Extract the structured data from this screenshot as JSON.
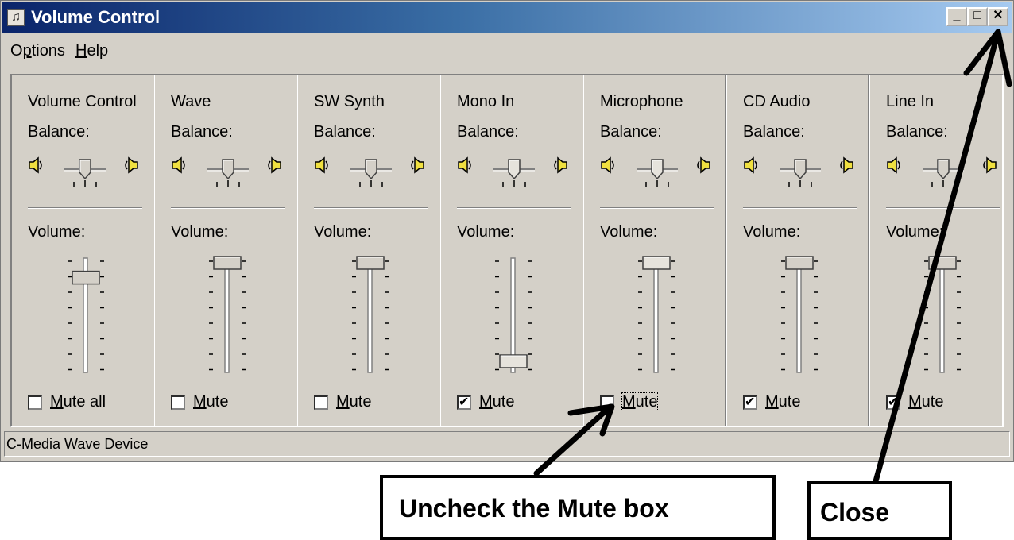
{
  "window": {
    "title": "Volume Control",
    "controls": {
      "minimize": "_",
      "maximize": "□",
      "close": "✕"
    }
  },
  "menu": [
    {
      "label": "Options",
      "underline_index": 1
    },
    {
      "label": "Help",
      "underline_index": 0
    }
  ],
  "panels": [
    {
      "name": "Volume Control",
      "balance_label": "Balance:",
      "volume_label": "Volume:",
      "mute_label": "Mute all",
      "muted": false,
      "volume_level": 0.85,
      "disabled": false
    },
    {
      "name": "Wave",
      "balance_label": "Balance:",
      "volume_label": "Volume:",
      "mute_label": "Mute",
      "muted": false,
      "volume_level": 1.0,
      "disabled": false
    },
    {
      "name": "SW Synth",
      "balance_label": "Balance:",
      "volume_label": "Volume:",
      "mute_label": "Mute",
      "muted": false,
      "volume_level": 1.0,
      "disabled": false
    },
    {
      "name": "Mono In",
      "balance_label": "Balance:",
      "volume_label": "Volume:",
      "mute_label": "Mute",
      "muted": true,
      "volume_level": 0.0,
      "disabled": true
    },
    {
      "name": "Microphone",
      "balance_label": "Balance:",
      "volume_label": "Volume:",
      "mute_label": "Mute",
      "muted": false,
      "volume_level": 1.0,
      "disabled": true,
      "focused": true
    },
    {
      "name": "CD Audio",
      "balance_label": "Balance:",
      "volume_label": "Volume:",
      "mute_label": "Mute",
      "muted": true,
      "volume_level": 1.0,
      "disabled": false
    },
    {
      "name": "Line In",
      "balance_label": "Balance:",
      "volume_label": "Volume:",
      "mute_label": "Mute",
      "muted": true,
      "volume_level": 1.0,
      "disabled": false
    }
  ],
  "status": "C-Media Wave Device",
  "annotations": {
    "uncheck": "Uncheck the Mute box",
    "close": "Close"
  },
  "colors": {
    "titlebar_start": "#0a246a",
    "titlebar_end": "#a6caf0",
    "window_bg": "#d4d0c8"
  }
}
